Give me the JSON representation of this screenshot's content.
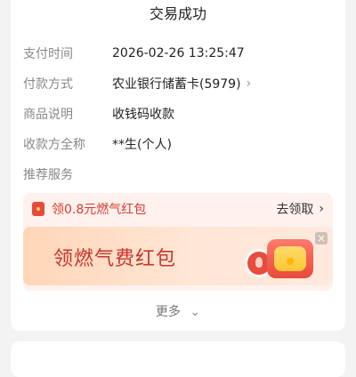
{
  "header": {
    "title": "交易成功"
  },
  "details": [
    {
      "label": "支付时间",
      "value": "2026-02-26 13:25:47"
    },
    {
      "label": "付款方式",
      "value": "农业银行储蓄卡(5979)"
    },
    {
      "label": "商品说明",
      "value": "收钱码收款"
    },
    {
      "label": "收款方全称",
      "value": "**生(个人)"
    }
  ],
  "section": {
    "recommended": "推荐服务"
  },
  "promo": {
    "offer_text": "领0.8元燃气红包",
    "cta": "去领取",
    "banner_title": "领燃气费红包",
    "close": "×",
    "colors": {
      "accent": "#d73b2e",
      "banner_start": "#ffd6b8",
      "banner_end": "#ffe9de"
    }
  },
  "footer": {
    "more": "更多"
  },
  "icons": {
    "chevron_right": "›",
    "chevron_down": "⌄"
  }
}
